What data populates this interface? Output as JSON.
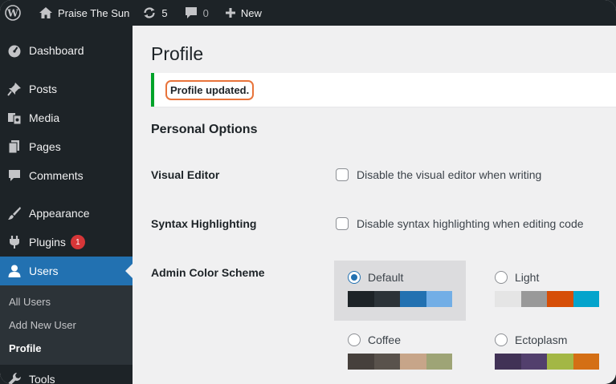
{
  "adminbar": {
    "site_name": "Praise The Sun",
    "updates_count": "5",
    "comments_count": "0",
    "new_label": "New"
  },
  "sidebar": {
    "items": [
      {
        "label": "Dashboard",
        "icon": "dashboard-icon"
      },
      {
        "label": "Posts",
        "icon": "pin-icon"
      },
      {
        "label": "Media",
        "icon": "media-icon"
      },
      {
        "label": "Pages",
        "icon": "pages-icon"
      },
      {
        "label": "Comments",
        "icon": "comment-icon"
      },
      {
        "label": "Appearance",
        "icon": "brush-icon"
      },
      {
        "label": "Plugins",
        "icon": "plugin-icon",
        "badge": "1"
      },
      {
        "label": "Users",
        "icon": "user-icon",
        "current": true
      },
      {
        "label": "Tools",
        "icon": "wrench-icon"
      }
    ],
    "submenu": [
      {
        "label": "All Users"
      },
      {
        "label": "Add New User"
      },
      {
        "label": "Profile",
        "current": true
      }
    ]
  },
  "main": {
    "title": "Profile",
    "notice": "Profile updated.",
    "section_title": "Personal Options",
    "visual_editor": {
      "label": "Visual Editor",
      "option": "Disable the visual editor when writing"
    },
    "syntax": {
      "label": "Syntax Highlighting",
      "option": "Disable syntax highlighting when editing code"
    },
    "color_scheme": {
      "label": "Admin Color Scheme",
      "schemes": [
        {
          "name": "Default",
          "selected": true,
          "colors": [
            "#1d2327",
            "#2c3338",
            "#2271b1",
            "#72aee6"
          ]
        },
        {
          "name": "Light",
          "selected": false,
          "colors": [
            "#e5e5e5",
            "#999999",
            "#d64e07",
            "#04a4cc"
          ]
        },
        {
          "name": "Coffee",
          "selected": false,
          "colors": [
            "#46403c",
            "#59524c",
            "#c7a589",
            "#9ea476"
          ]
        },
        {
          "name": "Ectoplasm",
          "selected": false,
          "colors": [
            "#413256",
            "#523f6d",
            "#a3b745",
            "#d46f15"
          ]
        }
      ]
    }
  },
  "colors": {
    "accent": "#2271b1",
    "success": "#00a32a",
    "highlight": "#e8743b",
    "badge": "#d63638"
  }
}
